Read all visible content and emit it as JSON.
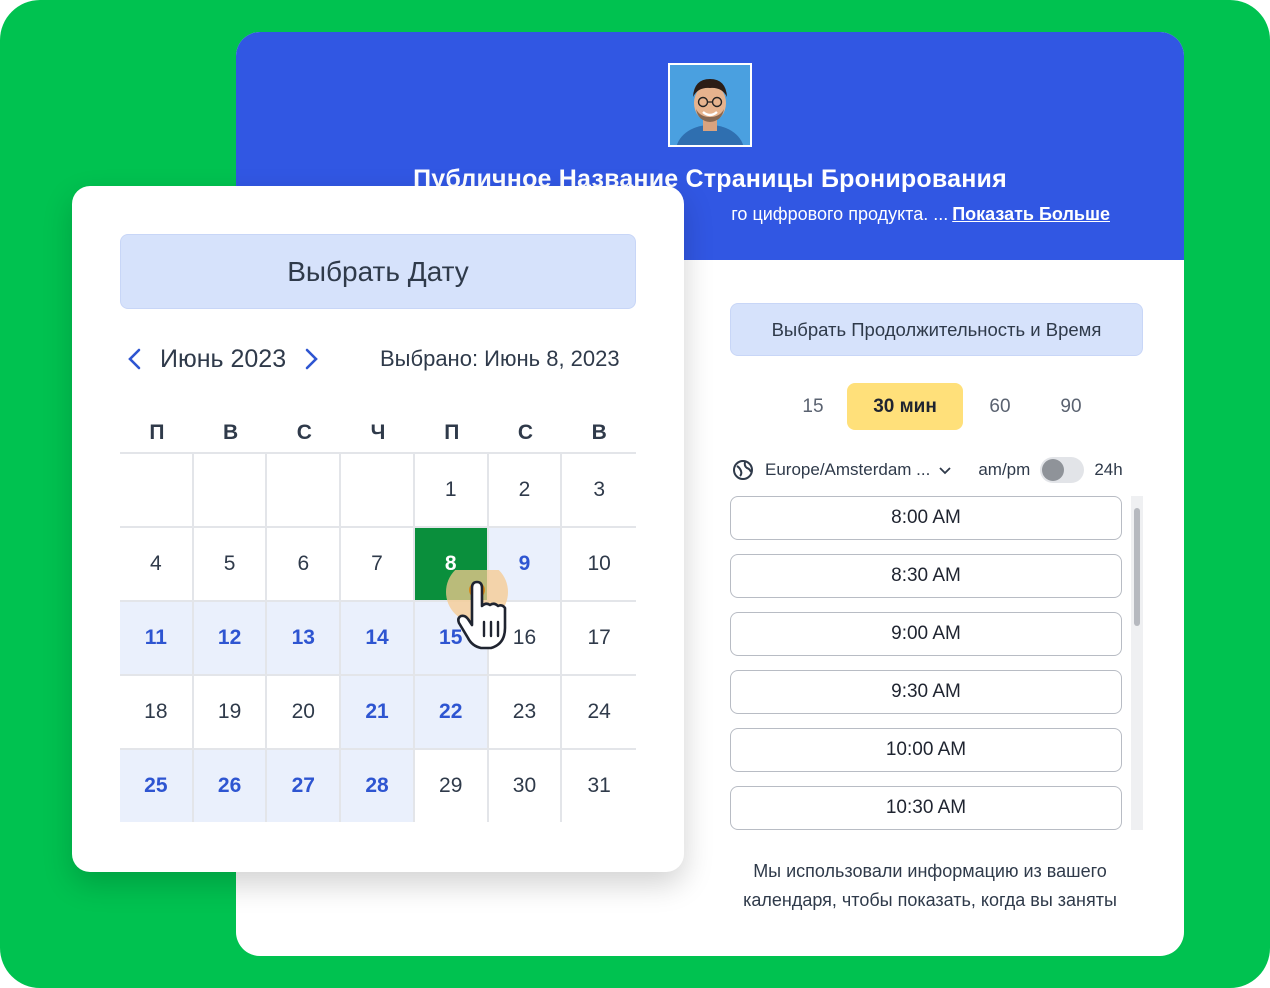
{
  "booking_page": {
    "title": "Публичное Название Страницы Бронирования",
    "description_fragment": "го цифрового продукта. ...",
    "show_more": "Показать Больше",
    "duration_title": "Выбрать Продолжительность и Время",
    "durations": [
      "15",
      "30 мин",
      "60",
      "90"
    ],
    "selected_duration": "30 мин",
    "timezone": "Europe/Amsterdam ...",
    "ampm_label": "am/pm",
    "h24_label": "24h",
    "time_slots": [
      "8:00 AM",
      "8:30 AM",
      "9:00 AM",
      "9:30 AM",
      "10:00 AM",
      "10:30 AM"
    ],
    "note_line1": "Мы использовали информацию из вашего",
    "note_line2": "календаря, чтобы показать, когда вы заняты"
  },
  "calendar": {
    "title": "Выбрать Дату",
    "month": "Июнь 2023",
    "selected_label": "Выбрано: Июнь 8, 2023",
    "weekdays": [
      "П",
      "В",
      "С",
      "Ч",
      "П",
      "С",
      "В"
    ],
    "weeks": [
      [
        {
          "d": "",
          "s": "empty"
        },
        {
          "d": "",
          "s": "empty"
        },
        {
          "d": "",
          "s": "empty"
        },
        {
          "d": "",
          "s": "empty"
        },
        {
          "d": "1",
          "s": "plain"
        },
        {
          "d": "2",
          "s": "plain"
        },
        {
          "d": "3",
          "s": "plain"
        }
      ],
      [
        {
          "d": "4",
          "s": "plain"
        },
        {
          "d": "5",
          "s": "plain"
        },
        {
          "d": "6",
          "s": "plain"
        },
        {
          "d": "7",
          "s": "plain"
        },
        {
          "d": "8",
          "s": "sel"
        },
        {
          "d": "9",
          "s": "avail"
        },
        {
          "d": "10",
          "s": "plain"
        }
      ],
      [
        {
          "d": "11",
          "s": "avail"
        },
        {
          "d": "12",
          "s": "avail"
        },
        {
          "d": "13",
          "s": "avail"
        },
        {
          "d": "14",
          "s": "avail"
        },
        {
          "d": "15",
          "s": "avail"
        },
        {
          "d": "16",
          "s": "plain"
        },
        {
          "d": "17",
          "s": "plain"
        }
      ],
      [
        {
          "d": "18",
          "s": "plain"
        },
        {
          "d": "19",
          "s": "plain"
        },
        {
          "d": "20",
          "s": "plain"
        },
        {
          "d": "21",
          "s": "avail"
        },
        {
          "d": "22",
          "s": "avail"
        },
        {
          "d": "23",
          "s": "plain"
        },
        {
          "d": "24",
          "s": "plain"
        }
      ],
      [
        {
          "d": "25",
          "s": "avail"
        },
        {
          "d": "26",
          "s": "avail"
        },
        {
          "d": "27",
          "s": "avail"
        },
        {
          "d": "28",
          "s": "avail"
        },
        {
          "d": "29",
          "s": "plain"
        },
        {
          "d": "30",
          "s": "plain"
        },
        {
          "d": "31",
          "s": "plain"
        }
      ]
    ]
  },
  "colors": {
    "frame": "#00c250",
    "hero": "#3157e3",
    "selected_day": "#0a8f3c",
    "available_day_text": "#2e55d1",
    "duration_active": "#ffe07a"
  },
  "icons": [
    "chevron-left-icon",
    "chevron-right-icon",
    "globe-icon",
    "chevron-down-icon",
    "hand-pointer-icon",
    "avatar-photo"
  ]
}
